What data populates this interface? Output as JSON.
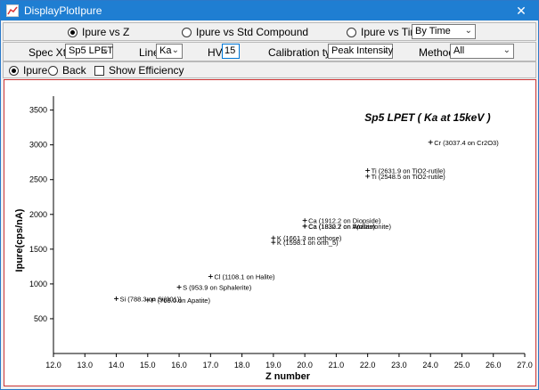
{
  "window": {
    "title": "DisplayPlotIpure"
  },
  "modes": [
    {
      "label": "Ipure vs Z",
      "selected": true
    },
    {
      "label": "Ipure vs Std Compound",
      "selected": false
    },
    {
      "label": "Ipure vs Time",
      "selected": false
    }
  ],
  "time_combo": {
    "value": "By Time"
  },
  "controls": {
    "spec_xtal_label": "Spec Xtal",
    "spec_xtal_value": "Sp5 LPET",
    "line_label": "Line",
    "line_value": "Ka",
    "hv_label": "HV",
    "hv_value": "15",
    "calibration_label": "Calibration type",
    "calibration_value": "Peak Intensity",
    "method_label": "Method",
    "method_value": "All"
  },
  "view": {
    "ipure_label": "Ipure",
    "ipure_selected": true,
    "back_label": "Back",
    "show_efficiency_label": "Show Efficiency"
  },
  "chart_data": {
    "type": "scatter",
    "title": "Sp5 LPET ( Ka at 15keV )",
    "xlabel": "Z number",
    "ylabel": "Ipure(cps/nA)",
    "xlim": [
      12.0,
      27.0
    ],
    "ylim": [
      0,
      3700
    ],
    "x_ticks": [
      "12.0",
      "13.0",
      "14.0",
      "15.0",
      "16.0",
      "17.0",
      "18.0",
      "19.0",
      "20.0",
      "21.0",
      "22.0",
      "23.0",
      "24.0",
      "25.0",
      "26.0",
      "27.0"
    ],
    "y_ticks": [
      "500",
      "1000",
      "1500",
      "2000",
      "2500",
      "3000",
      "3500"
    ],
    "points": [
      {
        "x": 14.0,
        "y": 788.3,
        "label": "Si (788.3 on Si(001))"
      },
      {
        "x": 15.0,
        "y": 769.0,
        "label": "P (769.0 on Apatite)"
      },
      {
        "x": 16.0,
        "y": 953.9,
        "label": "S  (953.9 on Sphalerite)"
      },
      {
        "x": 17.0,
        "y": 1108.1,
        "label": "Cl (1108.1 on Halite)"
      },
      {
        "x": 19.0,
        "y": 1661.3,
        "label": "K  (1661.3 on orthose)"
      },
      {
        "x": 19.0,
        "y": 1598.1,
        "label": "K  (1598.1 on orth_5)"
      },
      {
        "x": 20.0,
        "y": 1912.2,
        "label": "Ca (1912.2 on Diopside)"
      },
      {
        "x": 20.0,
        "y": 1832.7,
        "label": "Ca (1832.7 on Apatite)"
      },
      {
        "x": 20.0,
        "y": 1830.2,
        "label": "Ca (1830.2 on Wollastonite)"
      },
      {
        "x": 22.0,
        "y": 2631.9,
        "label": "Ti (2631.9 on TiO2-rutile)"
      },
      {
        "x": 22.0,
        "y": 2548.5,
        "label": "Ti (2548.5 on TiO2-rutile)"
      },
      {
        "x": 24.0,
        "y": 3037.4,
        "label": "Cr (3037.4 on Cr2O3)"
      }
    ]
  }
}
